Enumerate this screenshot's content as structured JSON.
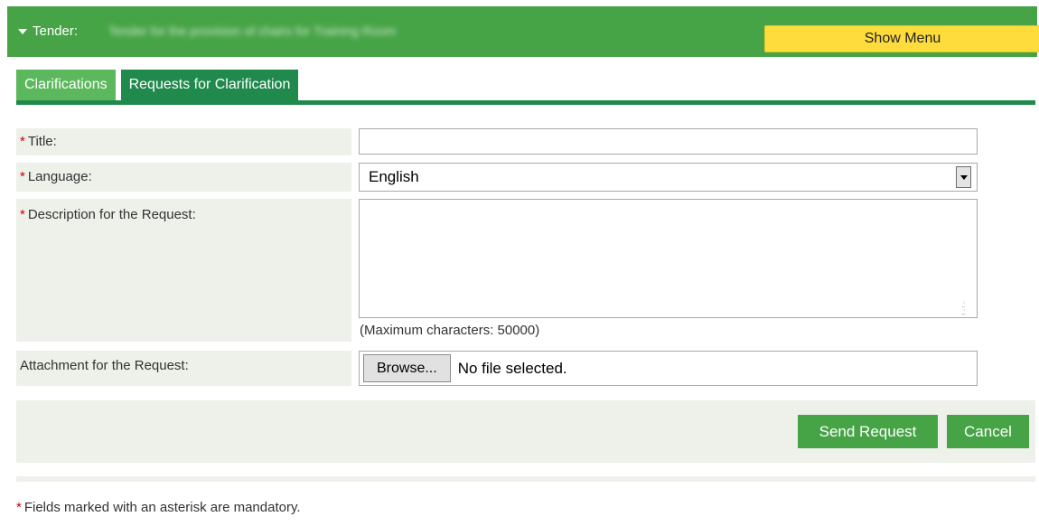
{
  "header": {
    "tender_label": "Tender:",
    "tender_name": "Tender for the provision of chairs for Training Room",
    "show_menu": "Show Menu"
  },
  "tabs": [
    {
      "label": "Clarifications",
      "active": false
    },
    {
      "label": "Requests for Clarification",
      "active": true
    }
  ],
  "form": {
    "asterisk": "*",
    "title_label": "Title:",
    "title_value": "",
    "language_label": "Language:",
    "language_value": "English",
    "description_label": "Description for the Request:",
    "description_value": "",
    "max_chars": "(Maximum characters: 50000)",
    "attachment_label": "Attachment for the Request:",
    "browse_label": "Browse...",
    "file_status": "No file selected."
  },
  "actions": {
    "send": "Send Request",
    "cancel": "Cancel"
  },
  "footnote": "Fields marked with an asterisk are mandatory.",
  "colors": {
    "header_green": "#46a446",
    "tab_active": "#1f8a4c",
    "tab_inactive": "#5cb85c",
    "show_menu_yellow": "#fddc3c",
    "label_bg": "#eef0ea",
    "required_red": "#cc0000"
  }
}
